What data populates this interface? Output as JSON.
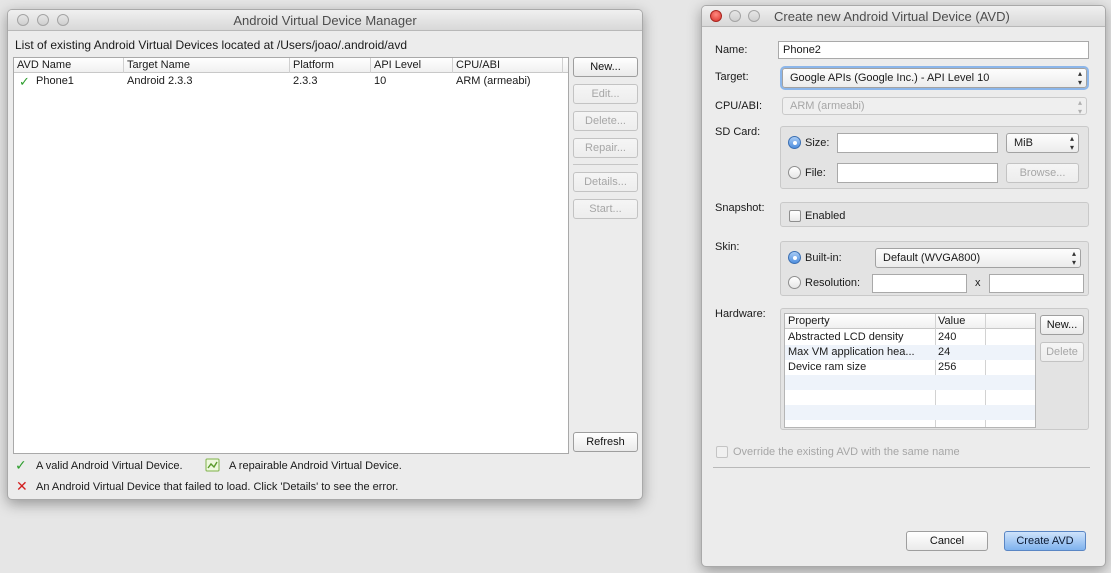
{
  "manager": {
    "title": "Android Virtual Device Manager",
    "location_text": "List of existing Android Virtual Devices located at /Users/joao/.android/avd",
    "columns": [
      "AVD Name",
      "Target Name",
      "Platform",
      "API Level",
      "CPU/ABI"
    ],
    "rows": [
      {
        "name": "Phone1",
        "target": "Android 2.3.3",
        "platform": "2.3.3",
        "api": "10",
        "cpu": "ARM (armeabi)"
      }
    ],
    "buttons": {
      "new": "New...",
      "edit": "Edit...",
      "delete": "Delete...",
      "repair": "Repair...",
      "details": "Details...",
      "start": "Start...",
      "refresh": "Refresh"
    },
    "legend": {
      "valid": "A valid Android Virtual Device.",
      "repairable": "A repairable Android Virtual Device.",
      "failed": "An Android Virtual Device that failed to load. Click 'Details' to see the error."
    }
  },
  "dialog": {
    "title": "Create new Android Virtual Device (AVD)",
    "name_label": "Name:",
    "name_value": "Phone2",
    "target_label": "Target:",
    "target_value": "Google APIs (Google Inc.) - API Level 10",
    "cpu_label": "CPU/ABI:",
    "cpu_value": "ARM (armeabi)",
    "sdcard_label": "SD Card:",
    "size_label": "Size:",
    "size_value": "",
    "size_unit": "MiB",
    "file_label": "File:",
    "file_value": "",
    "browse_label": "Browse...",
    "snapshot_label": "Snapshot:",
    "enabled_label": "Enabled",
    "skin_label": "Skin:",
    "builtin_label": "Built-in:",
    "builtin_value": "Default (WVGA800)",
    "resolution_label": "Resolution:",
    "res_x": "x",
    "hardware_label": "Hardware:",
    "hw_columns": [
      "Property",
      "Value"
    ],
    "hw_rows": [
      {
        "property": "Abstracted LCD density",
        "value": "240"
      },
      {
        "property": "Max VM application hea...",
        "value": "24"
      },
      {
        "property": "Device ram size",
        "value": "256"
      }
    ],
    "hw_new": "New...",
    "hw_delete": "Delete",
    "override_label": "Override the existing AVD with the same name",
    "cancel": "Cancel",
    "create": "Create AVD"
  },
  "colors": {
    "check_green": "#2e9e2e",
    "error_red": "#d21f1f",
    "accent_blue": "#4f8fdf"
  }
}
